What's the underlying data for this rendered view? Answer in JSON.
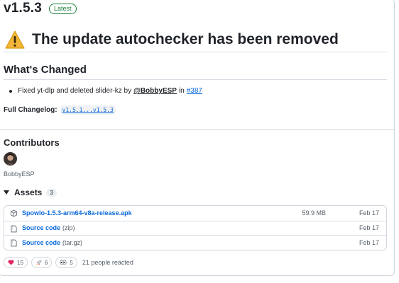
{
  "release": {
    "version": "v1.5.3",
    "badge": "Latest",
    "headline": "The update autochecker has been removed",
    "whats_changed": "What's Changed",
    "change": {
      "text": "Fixed yt-dlp and deleted slider-kz by",
      "user": "@BobbyESP",
      "in": "in",
      "issue": "#387"
    },
    "changelog_label": "Full Changelog:",
    "changelog_link": "v1.5.1...v1.5.3"
  },
  "contributors": {
    "title": "Contributors",
    "names": [
      "BobbyESP"
    ]
  },
  "assets": {
    "title": "Assets",
    "count": "3",
    "items": [
      {
        "name": "Spowlo-1.5.3-arm64-v8a-release.apk",
        "kind": "",
        "size": "59.9 MB",
        "date": "Feb 17",
        "icon": "package-icon"
      },
      {
        "name": "Source code",
        "kind": "(zip)",
        "size": "",
        "date": "Feb 17",
        "icon": "file-zip-icon"
      },
      {
        "name": "Source code",
        "kind": "(tar.gz)",
        "size": "",
        "date": "Feb 17",
        "icon": "file-zip-icon"
      }
    ]
  },
  "reactions": {
    "heart": "15",
    "rocket": "6",
    "eyes": "5",
    "summary": "21 people reacted"
  },
  "colors": {
    "link": "#0969da",
    "latest_badge": "#1a7f37",
    "warning": "#d4a72c"
  }
}
